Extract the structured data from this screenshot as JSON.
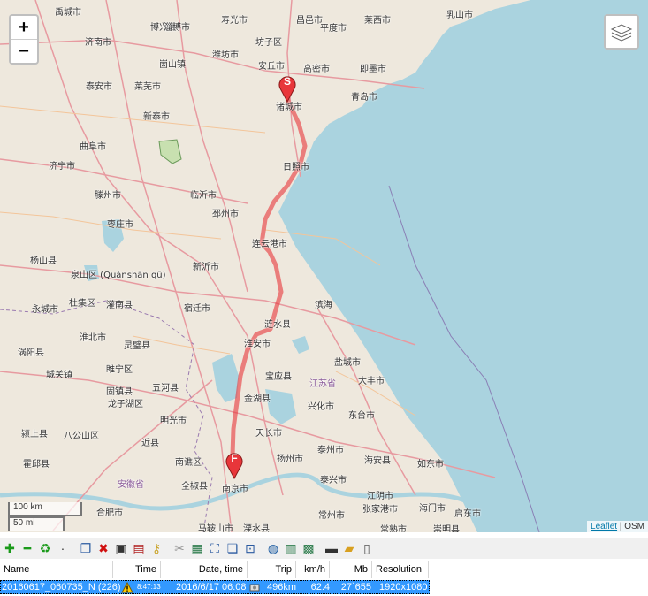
{
  "map": {
    "zoom_in": "+",
    "zoom_out": "−",
    "layers_icon": "layers-icon",
    "scale_km": "100 km",
    "scale_mi": "50 mi",
    "attribution_link": "Leaflet",
    "attribution_sep": " | ",
    "attribution_osm": "OSM",
    "start_marker": "S",
    "finish_marker": "F",
    "track_color": "#e8363a",
    "water_color": "#aad3df",
    "cities": [
      "禹城市",
      "博兴县",
      "淄博市",
      "寿光市",
      "昌邑市",
      "平度市",
      "莱西市",
      "乳山市",
      "济南市",
      "潍坊市",
      "坊子区",
      "泰安市",
      "崮山镇",
      "莱芜市",
      "安丘市",
      "高密市",
      "即墨市",
      "新泰市",
      "诸城市",
      "青岛市",
      "曲阜市",
      "济宁市",
      "日照市",
      "临沂市",
      "滕州市",
      "枣庄市",
      "连云港市",
      "邳州市",
      "新沂市",
      "泉山区 (Quánshān qū)",
      "杨山县",
      "永城市",
      "杜集区",
      "宿迁市",
      "灌南县",
      "滨海",
      "涟水县",
      "淮安市",
      "淮北市",
      "灵璧县",
      "睢宁区",
      "盐城市",
      "涡阳县",
      "城关镇",
      "固镇县",
      "金湖县",
      "宝应县",
      "大丰市",
      "五河县",
      "江苏省",
      "兴化市",
      "东台市",
      "龙子湖区",
      "明光市",
      "颍上县",
      "八公山区",
      "天长市",
      "扬州市",
      "泰州市",
      "近县",
      "霍邱县",
      "南谯区",
      "全椒县",
      "南京市",
      "如东市",
      "海安县",
      "泰兴市",
      "安徽省",
      "江阴市",
      "合肥市",
      "马鞍山市",
      "溧水县",
      "常州市",
      "张家港市",
      "海门市",
      "启东市",
      "常熟市",
      "崇明县"
    ],
    "labels_prov": [
      "江苏省",
      "安徽省"
    ]
  },
  "toolbar": {
    "icons": [
      "add-icon",
      "remove-icon",
      "refresh-icon",
      "dot-icon",
      "copy-icon",
      "delete-icon",
      "save-icon",
      "export-icon",
      "key-icon",
      "cut-icon",
      "map-add-icon",
      "crop-icon",
      "layers-copy-icon",
      "zoom-fit-icon",
      "globe-icon",
      "chart-icon",
      "map-edit-icon",
      "filmstrip-icon",
      "open-folder-icon",
      "document-icon"
    ]
  },
  "grid": {
    "headers": {
      "name": "Name",
      "time": "Time",
      "datetime": "Date, time",
      "trip": "Trip",
      "kmh": "km/h",
      "mb": "Mb",
      "resolution": "Resolution"
    },
    "row": {
      "name": "20160617_060735_N (226)",
      "time": "8:47:13",
      "datetime": "2016/6/17 06:08",
      "trip": "496km",
      "kmh": "62.4",
      "mb": "27`655",
      "resolution": "1920x1080"
    }
  }
}
